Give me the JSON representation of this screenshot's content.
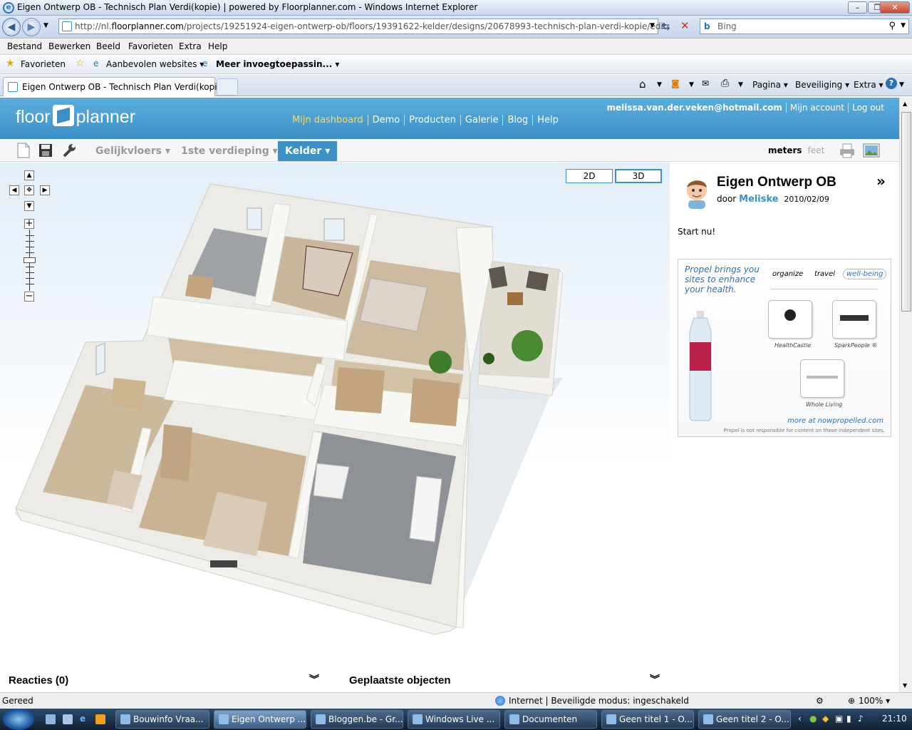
{
  "window": {
    "title": "Eigen Ontwerp OB - Technisch Plan Verdi(kopie) | powered by Floorplanner.com - Windows Internet Explorer"
  },
  "address": {
    "url_prefix": "http://nl.",
    "url_domain": "floorplanner.com",
    "url_path": "/projects/19251924-eigen-ontwerp-ob/floors/19391622-kelder/designs/20678993-technisch-plan-verdi-kopie/edit",
    "search_placeholder": "Bing"
  },
  "menu": [
    "Bestand",
    "Bewerken",
    "Beeld",
    "Favorieten",
    "Extra",
    "Help"
  ],
  "favorites": {
    "favorites_label": "Favorieten",
    "suggested": "Aanbevolen websites ▾",
    "addons": "Meer invoegtoepassin... ▾"
  },
  "tabs": {
    "active": "Eigen Ontwerp OB - Technisch Plan Verdi(kopie) ...",
    "page": "Pagina ▾",
    "security": "Beveiliging ▾",
    "extra": "Extra ▾"
  },
  "site": {
    "logo_left": "floor",
    "logo_right": "planner",
    "nav": [
      "Mijn dashboard",
      "Demo",
      "Producten",
      "Galerie",
      "Blog",
      "Help"
    ],
    "account_email": "melissa.van.der.veken@hotmail.com",
    "account_link": "Mijn account",
    "logout": "Log out"
  },
  "toolbar": {
    "floors": [
      "Gelijkvloers ▾",
      "1ste verdieping ▾",
      "Kelder ▾"
    ],
    "unit_meters": "meters",
    "unit_feet": "feet"
  },
  "view": {
    "mode_2d": "2D",
    "mode_3d": "3D"
  },
  "project": {
    "title": "Eigen Ontwerp OB",
    "by": "door",
    "author": "Meliske",
    "date": "2010/02/09",
    "start": "Start nu!",
    "chevron": "»"
  },
  "ad": {
    "tagline": "Propel brings you sites to enhance your health.",
    "tabs": [
      "organize",
      "travel",
      "well-being"
    ],
    "sites": [
      "HealthCastle",
      "SparkPeople ®",
      "Whole Living"
    ],
    "more": "more at nowpropelled.com",
    "disclaimer": "Propel is not responsible for content on these independent sites."
  },
  "bottom": {
    "comments": "Reacties (0)",
    "placed": "Geplaatste objecten"
  },
  "status": {
    "left": "Gereed",
    "zone": "Internet | Beveiligde modus: ingeschakeld",
    "zoom": "100% ▾"
  },
  "taskbar": {
    "items": [
      "Bouwinfo Vraa...",
      "Eigen Ontwerp ...",
      "Bloggen.be - Gr...",
      "Windows Live ...",
      "Documenten",
      "Geen titel 1 - O...",
      "Geen titel 2 - O..."
    ],
    "clock": "21:10"
  },
  "colors": {
    "brand": "#3d90c6",
    "active_nav": "#ffd95a"
  }
}
